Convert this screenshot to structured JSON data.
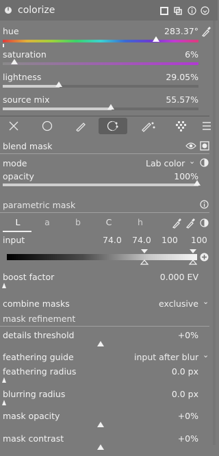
{
  "header": {
    "title": "colorize",
    "icons": [
      "power-icon",
      "preset-icon",
      "multi-instance-icon",
      "info-icon",
      "reset-icon"
    ]
  },
  "sliders": [
    {
      "label": "hue",
      "value": "283.37°",
      "level": 0.787
    },
    {
      "label": "saturation",
      "value": "6%",
      "level": 0.06
    },
    {
      "label": "lightness",
      "value": "29.05%",
      "level": 0.2905
    },
    {
      "label": "source mix",
      "value": "55.57%",
      "level": 0.5557
    }
  ],
  "mask_tabs": [
    "off-icon",
    "uniform-icon",
    "drawn-icon",
    "parametric-icon",
    "drawn-parametric-icon",
    "raster-icon",
    "menu-icon"
  ],
  "blend": {
    "section": "blend mask",
    "mode_label": "mode",
    "mode_value": "Lab color",
    "opacity_label": "opacity",
    "opacity_value": "100%",
    "opacity_level": 1.0
  },
  "parametric": {
    "section": "parametric mask",
    "channels": [
      "L",
      "a",
      "b",
      "C",
      "h"
    ],
    "active_channel": "L",
    "input_label": "input",
    "input_values": [
      "74.0",
      "74.0",
      "100",
      "100"
    ]
  },
  "boost": {
    "label": "boost factor",
    "value": "0.000 EV"
  },
  "combine": {
    "label": "combine masks",
    "value": "exclusive"
  },
  "refinement": {
    "section": "mask refinement"
  },
  "refine_rows": [
    {
      "label": "details threshold",
      "value": "+0%"
    },
    {
      "label": "feathering guide",
      "value": "input after blur"
    },
    {
      "label": "feathering radius",
      "value": "0.0 px"
    },
    {
      "label": "blurring radius",
      "value": "0.0 px"
    },
    {
      "label": "mask opacity",
      "value": "+0%"
    },
    {
      "label": "mask contrast",
      "value": "+0%"
    }
  ]
}
